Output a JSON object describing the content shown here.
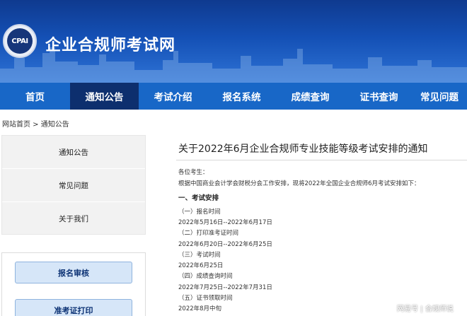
{
  "header": {
    "logo_text": "CPAI",
    "site_title": "企业合规师考试网"
  },
  "nav": {
    "items": [
      {
        "label": "首页",
        "active": false
      },
      {
        "label": "通知公告",
        "active": true
      },
      {
        "label": "考试介绍",
        "active": false
      },
      {
        "label": "报名系统",
        "active": false
      },
      {
        "label": "成绩查询",
        "active": false
      },
      {
        "label": "证书查询",
        "active": false
      },
      {
        "label": "常见问题",
        "active": false
      }
    ]
  },
  "breadcrumb": {
    "home": "网站首页",
    "separator": " > ",
    "current": "通知公告"
  },
  "sidebar": {
    "menu": [
      "通知公告",
      "常见问题",
      "关于我们"
    ],
    "buttons": [
      "报名审核",
      "准考证打印"
    ]
  },
  "article": {
    "title": "关于2022年6月企业合规师专业技能等级考试安排的通知",
    "greeting": "各位考生：",
    "intro": "根据中国商业会计学会财税分会工作安排，现将2022年全国企业合规师6月考试安排如下：",
    "section1": "一、考试安排",
    "items": [
      {
        "label": "（一）报名时间",
        "value": "2022年5月16日--2022年6月17日"
      },
      {
        "label": "（二）打印准考证时间",
        "value": "2022年6月20日--2022年6月25日"
      },
      {
        "label": "（三）考试时间",
        "value": "2022年6月25日"
      },
      {
        "label": "（四）成绩查询时间",
        "value": "2022年7月25日--2022年7月31日"
      },
      {
        "label": "（五）证书领取时间",
        "value": "2022年8月中旬"
      }
    ]
  },
  "watermark": "网易号 | 合规师说",
  "colors": {
    "nav_bg": "#1867c7",
    "nav_active_bg": "#0d2f6e",
    "banner_top": "#0f3a8f",
    "button_bg": "#d6e6f8"
  }
}
